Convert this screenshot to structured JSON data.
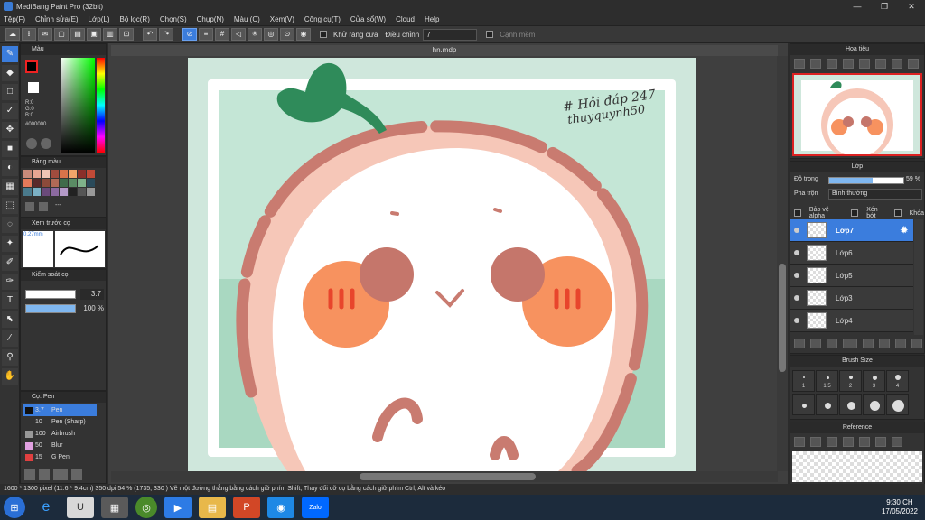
{
  "window": {
    "title": "MediBang Paint Pro (32bit)"
  },
  "menu": [
    "Tệp(F)",
    "Chỉnh sửa(E)",
    "Lớp(L)",
    "Bộ lọc(R)",
    "Chọn(S)",
    "Chụp(N)",
    "Màu (C)",
    "Xem(V)",
    "Công cụ(T)",
    "Cửa sổ(W)",
    "Cloud",
    "Help"
  ],
  "toolbar": {
    "antialias_label": "Khử răng cưa",
    "correction_label": "Điều chỉnh",
    "correction_value": "7",
    "snap_label": "Cạnh mềm"
  },
  "color_panel": {
    "title": "Màu",
    "r": "R:0",
    "g": "G:0",
    "b": "B:0",
    "hex": "#000000",
    "accent": "#000000"
  },
  "swatch_panel": {
    "title": "Bảng màu",
    "more": "---"
  },
  "preview_panel": {
    "title": "Xem trước cọ",
    "size": "0.27mm"
  },
  "control_panel": {
    "title": "Kiểm soát cọ",
    "size_value": "3.7",
    "opacity_value": "100 %"
  },
  "brush_panel": {
    "title": "Cọ: Pen",
    "brushes": [
      {
        "size": "3.7",
        "name": "Pen",
        "swatch": "#111111"
      },
      {
        "size": "10",
        "name": "Pen (Sharp)",
        "swatch": "#333333"
      },
      {
        "size": "100",
        "name": "Airbrush",
        "swatch": "#999999"
      },
      {
        "size": "50",
        "name": "Blur",
        "swatch": "#e0a0e0"
      },
      {
        "size": "15",
        "name": "G Pen",
        "swatch": "#e04040"
      }
    ]
  },
  "canvas": {
    "doc_name": "hn.mdp",
    "watermark_line1": "# Hỏi đáp 247",
    "watermark_line2": "thuyquynh50"
  },
  "navigator": {
    "title": "Hoa tiêu"
  },
  "layers": {
    "title": "Lớp",
    "opacity_label": "Độ trong",
    "opacity_value": "59 %",
    "opacity_fraction": 0.59,
    "blend_label": "Pha trộn",
    "blend_value": "Bình thường",
    "protect_alpha": "Bảo vệ alpha",
    "clip": "Xén bớt",
    "lock": "Khóa",
    "items": [
      "Lớp7",
      "Lớp6",
      "Lớp5",
      "Lớp3",
      "Lớp4"
    ]
  },
  "brush_size": {
    "title": "Brush Size",
    "sizes": [
      "1",
      "1.5",
      "2",
      "3",
      "4"
    ]
  },
  "reference": {
    "title": "Reference"
  },
  "status": {
    "text": "1600 * 1300 pixel   (11.6 * 9.4cm)   350 dpi   54 %   (1735, 330 )   Vẽ một đường thẳng bằng cách giữ phím Shift, Thay đổi cỡ cọ bằng cách giữ phím Ctrl, Alt và kéo"
  },
  "taskbar": {
    "time": "9:30 CH",
    "date": "17/05/2022",
    "zalo": "Zalo"
  }
}
